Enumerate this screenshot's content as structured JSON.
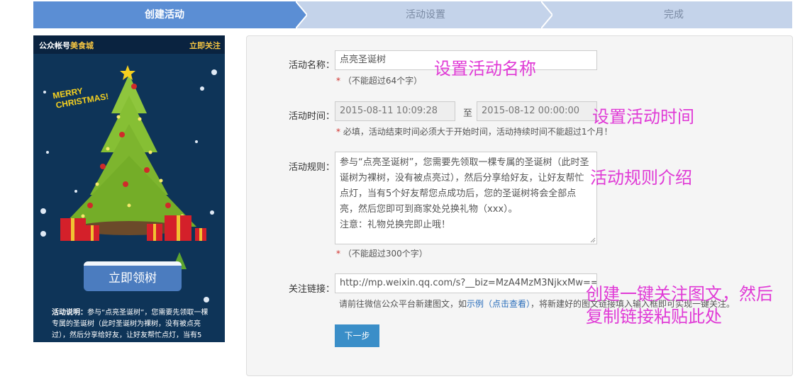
{
  "steps": {
    "step1": "创建活动",
    "step2": "活动设置",
    "step3": "完成"
  },
  "phone": {
    "account_prefix": "公众帐号",
    "account_name": "美食城",
    "follow_label": "立即关注",
    "banner_text": "MERRY CHRISTMAS!",
    "claim_button": "立即领树",
    "desc_title": "活动说明：",
    "desc_body": "参与“点亮圣诞树”，您需要先领取一棵专属的圣诞树（此时圣诞树为裸树，没有被点亮过），然后分享给好友，让好友帮忙点灯，当有5"
  },
  "form": {
    "name_label": "活动名称：",
    "name_value": "点亮圣诞树",
    "name_hint": "（不能超过64个字）",
    "time_label": "活动时间：",
    "start_time": "2015-08-11 10:09:28",
    "to_label": "至",
    "end_time": "2015-08-12 00:00:00",
    "time_hint": "必填，活动结束时间必须大于开始时间，活动持续时间不能超过1个月！",
    "rule_label": "活动规则：",
    "rule_value": "参与“点亮圣诞树”，您需要先领取一棵专属的圣诞树（此时圣诞树为裸树，没有被点亮过），然后分享给好友，让好友帮忙点灯，当有5个好友帮您点成功后，您的圣诞树将会全部点亮，然后您即可到商家处兑换礼物（xxx）。",
    "rule_note": "注意：礼物兑换完即止哦！",
    "rule_hint": "（不能超过300个字）",
    "link_label": "关注链接：",
    "link_value": "http://mp.weixin.qq.com/s?__biz=MzA4MzM3NjkxMw==",
    "link_hint_pre": "请前往微信公众平台新建图文，如",
    "link_hint_link": "示例（点击查看）",
    "link_hint_post": "，将新建好的图文链接填入输入框即可实现一键关注。",
    "next_button": "下一步"
  },
  "annotations": {
    "name": "设置活动名称",
    "time": "设置活动时间",
    "rule": "活动规则介绍",
    "link_line1": "创建一键关注图文，然后",
    "link_line2": "复制链接粘贴此处"
  },
  "colors": {
    "step_active": "#5b8ed4",
    "step_inactive": "#c4d3ea",
    "annotation": "#e03ad6",
    "primary_button": "#3a8ec8",
    "required": "#d0312d"
  }
}
